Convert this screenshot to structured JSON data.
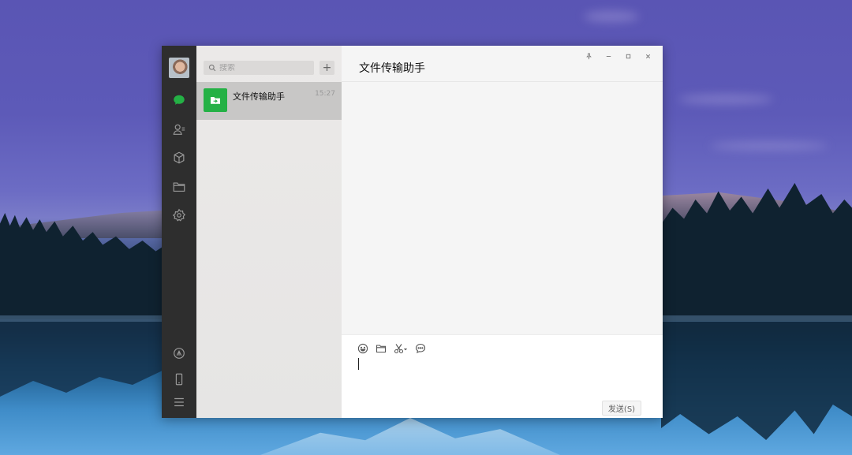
{
  "search": {
    "placeholder": "搜索"
  },
  "list": {
    "add_label": "+"
  },
  "chats": [
    {
      "name": "文件传输助手",
      "time": "15:27",
      "selected": true,
      "avatar_icon": "file-transfer-icon",
      "avatar_color": "#24b145"
    }
  ],
  "conversation": {
    "title": "文件传输助手"
  },
  "composer": {
    "value": "",
    "send_label": "发送(S)"
  },
  "nav_icons": [
    "avatar",
    "chat-icon",
    "contacts-icon",
    "favorites-icon",
    "files-icon",
    "mini-programs-icon",
    "moments-icon",
    "phone-icon",
    "menu-icon"
  ],
  "toolbar_icons": [
    "emoji-icon",
    "folder-icon",
    "screenshot-icon",
    "chat-history-icon"
  ],
  "window_controls": [
    "pin-icon",
    "minimize-icon",
    "maximize-icon",
    "close-icon"
  ],
  "colors": {
    "accent": "#24b145",
    "nav_bg": "#2e2e2e",
    "list_bg": "#e9e8e7",
    "selected_bg": "#c8c7c6"
  }
}
